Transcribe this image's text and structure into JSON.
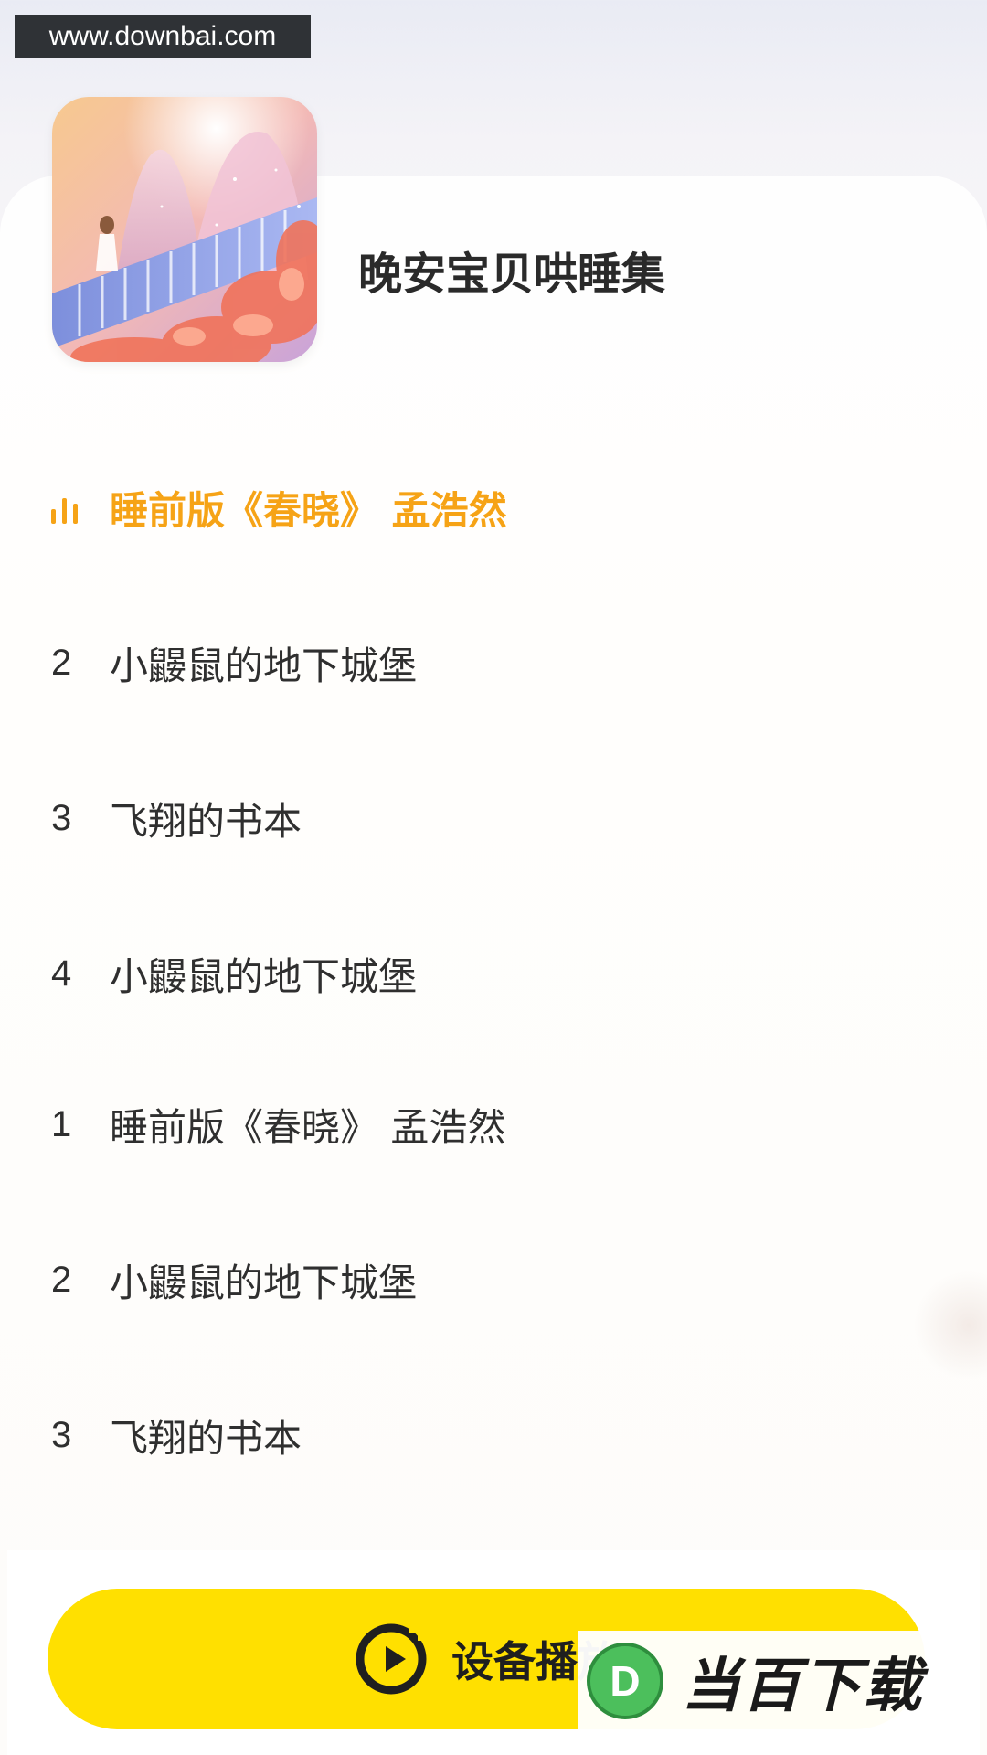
{
  "watermark_top": "www.downbai.com",
  "album": {
    "title": "晚安宝贝哄睡集",
    "cover_icon": "album-cover-art"
  },
  "tracks": [
    {
      "num": "",
      "title": "睡前版《春晓》 孟浩然",
      "active": true
    },
    {
      "num": "2",
      "title": "小鼹鼠的地下城堡",
      "active": false
    },
    {
      "num": "3",
      "title": "飞翔的书本",
      "active": false
    },
    {
      "num": "4",
      "title": "小鼹鼠的地下城堡",
      "active": false
    },
    {
      "num": "1",
      "title": "睡前版《春晓》 孟浩然",
      "active": false
    },
    {
      "num": "2",
      "title": "小鼹鼠的地下城堡",
      "active": false
    },
    {
      "num": "3",
      "title": "飞翔的书本",
      "active": false
    }
  ],
  "play_button": {
    "label": "设备播放",
    "icon": "play-circle-icon"
  },
  "brand_watermark": {
    "text": "当百下载",
    "logo": "D"
  },
  "colors": {
    "accent": "#f6a316",
    "button": "#ffe000",
    "text": "#2f2f2f"
  }
}
